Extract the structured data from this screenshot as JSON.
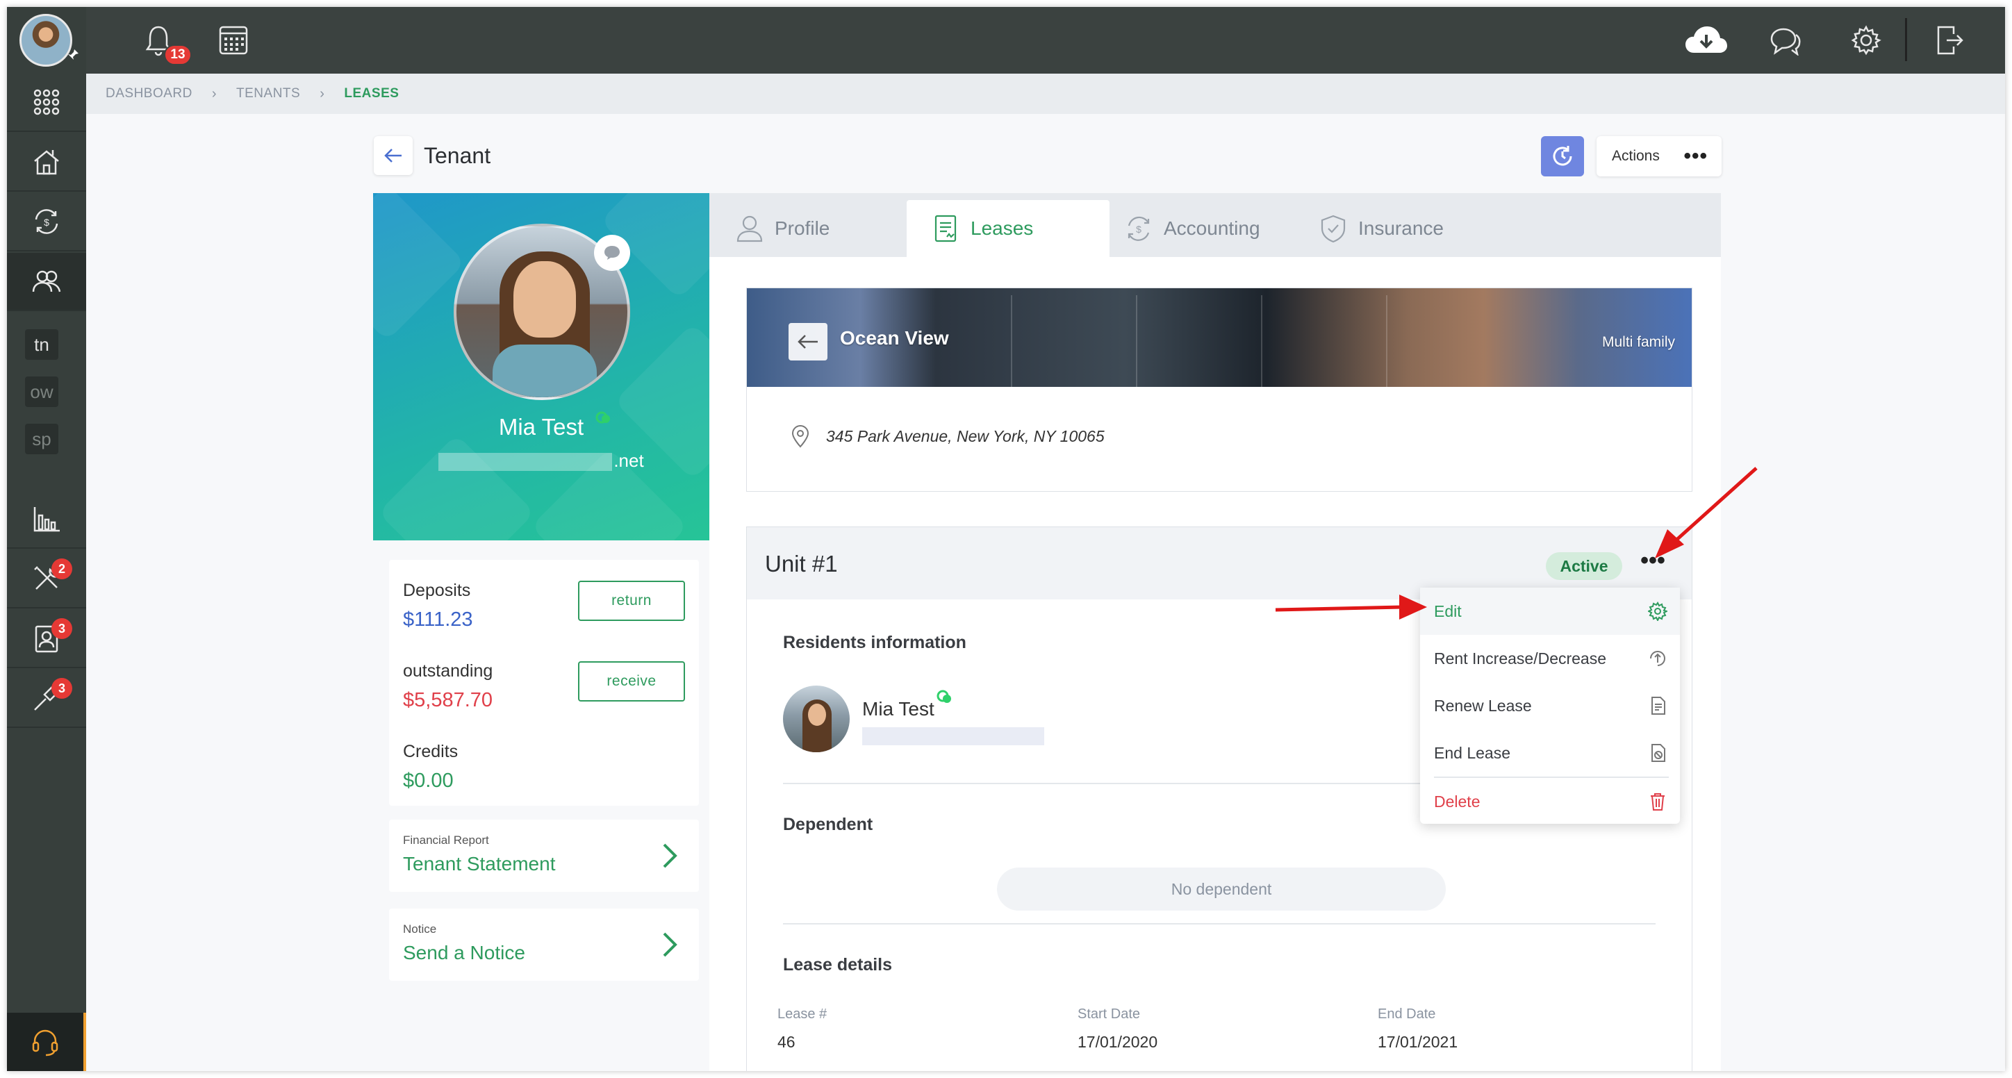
{
  "topbar": {
    "notifications_count": "13"
  },
  "sidebar": {
    "items": [
      {
        "icon": "apps-grid-icon"
      },
      {
        "icon": "properties-icon"
      },
      {
        "icon": "payments-icon"
      },
      {
        "icon": "people-icon"
      },
      {
        "abbr": "tn"
      },
      {
        "abbr": "ow"
      },
      {
        "abbr": "sp"
      },
      {
        "icon": "reports-icon"
      },
      {
        "icon": "maintenance-icon",
        "badge": "2"
      },
      {
        "icon": "contacts-icon",
        "badge": "3"
      },
      {
        "icon": "tools-icon",
        "badge": "3"
      }
    ]
  },
  "breadcrumb": [
    "DASHBOARD",
    "TENANTS",
    "LEASES"
  ],
  "page": {
    "title": "Tenant",
    "actions_label": "Actions"
  },
  "profile": {
    "name": "Mia Test",
    "email_suffix": ".net"
  },
  "balances": {
    "deposits_label": "Deposits",
    "deposits_value": "$111.23",
    "return_label": "return",
    "outstanding_label": "outstanding",
    "outstanding_value": "$5,587.70",
    "receive_label": "receive",
    "credits_label": "Credits",
    "credits_value": "$0.00"
  },
  "links": {
    "report_small": "Financial Report",
    "report_big": "Tenant Statement",
    "notice_small": "Notice",
    "notice_big": "Send a Notice"
  },
  "tabs": [
    "Profile",
    "Leases",
    "Accounting",
    "Insurance"
  ],
  "property": {
    "name": "Ocean View",
    "type": "Multi family",
    "address": "345 Park Avenue, New York, NY 10065"
  },
  "unit": {
    "title": "Unit #1",
    "status": "Active",
    "residents_title": "Residents information",
    "resident_name": "Mia Test",
    "dependent_title": "Dependent",
    "no_dependent": "No dependent",
    "lease_title": "Lease details",
    "lease_num_label": "Lease #",
    "lease_num": "46",
    "start_label": "Start Date",
    "start_date": "17/01/2020",
    "end_label": "End Date",
    "end_date": "17/01/2021"
  },
  "menu": {
    "edit": "Edit",
    "rent_change": "Rent Increase/Decrease",
    "renew": "Renew Lease",
    "end": "End Lease",
    "delete": "Delete"
  },
  "colors": {
    "accent_green": "#2e9b5e",
    "sidebar": "#373f3c",
    "topbar": "#3b4240",
    "danger": "#e0404a",
    "refresh_blue": "#6f86e0"
  }
}
